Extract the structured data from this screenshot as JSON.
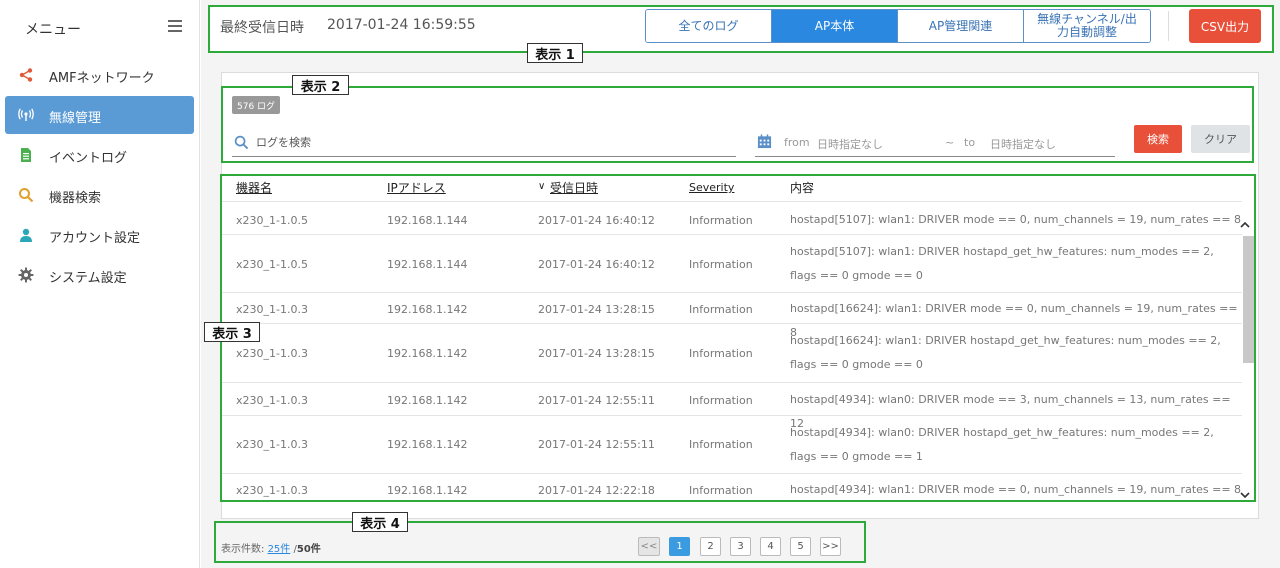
{
  "sidebar": {
    "title": "メニュー",
    "items": [
      {
        "label": "AMFネットワーク",
        "icon": "share-icon",
        "color": "#e05a3a"
      },
      {
        "label": "無線管理",
        "icon": "wireless-icon",
        "color": "#ffffff",
        "active": true
      },
      {
        "label": "イベントログ",
        "icon": "document-icon",
        "color": "#4caf50"
      },
      {
        "label": "機器検索",
        "icon": "search-icon",
        "color": "#e0a030"
      },
      {
        "label": "アカウント設定",
        "icon": "user-icon",
        "color": "#2aa8b8"
      },
      {
        "label": "システム設定",
        "icon": "gear-icon",
        "color": "#666666"
      }
    ]
  },
  "header": {
    "last_received_label": "最終受信日時",
    "last_received_time": "2017-01-24 16:59:55",
    "tabs": [
      {
        "label": "全てのログ",
        "active": false
      },
      {
        "label": "AP本体",
        "active": true
      },
      {
        "label": "AP管理関連",
        "active": false
      },
      {
        "label": "無線チャンネル/出力自動調整",
        "active": false
      }
    ],
    "csv_button": "CSV出力"
  },
  "annotations": {
    "box1": "表示 1",
    "box2": "表示 2",
    "box3": "表示 3",
    "box4": "表示 4"
  },
  "search": {
    "log_count": "576 ログ",
    "placeholder": "ログを検索",
    "from_label": "from",
    "from_value": "日時指定なし",
    "tilde": "~",
    "to_label": "to",
    "to_value": "日時指定なし",
    "search_button": "検索",
    "clear_button": "クリア"
  },
  "table": {
    "columns": [
      "機器名",
      "IPアドレス",
      "受信日時",
      "Severity",
      "内容"
    ],
    "sort_indicator": "∨",
    "rows": [
      {
        "device": "x230_1-1.0.5",
        "ip": "192.168.1.144",
        "time": "2017-01-24 16:40:12",
        "severity": "Information",
        "message": "hostapd[5107]: wlan1: DRIVER mode == 0, num_channels = 19, num_rates == 8"
      },
      {
        "device": "x230_1-1.0.5",
        "ip": "192.168.1.144",
        "time": "2017-01-24 16:40:12",
        "severity": "Information",
        "message": "hostapd[5107]: wlan1: DRIVER hostapd_get_hw_features: num_modes == 2, flags == 0 gmode == 0"
      },
      {
        "device": "x230_1-1.0.3",
        "ip": "192.168.1.142",
        "time": "2017-01-24 13:28:15",
        "severity": "Information",
        "message": "hostapd[16624]: wlan1: DRIVER mode == 0, num_channels = 19, num_rates == 8"
      },
      {
        "device": "x230_1-1.0.3",
        "ip": "192.168.1.142",
        "time": "2017-01-24 13:28:15",
        "severity": "Information",
        "message": "hostapd[16624]: wlan1: DRIVER hostapd_get_hw_features: num_modes == 2, flags == 0 gmode == 0"
      },
      {
        "device": "x230_1-1.0.3",
        "ip": "192.168.1.142",
        "time": "2017-01-24 12:55:11",
        "severity": "Information",
        "message": "hostapd[4934]: wlan0: DRIVER mode == 3, num_channels = 13, num_rates == 12"
      },
      {
        "device": "x230_1-1.0.3",
        "ip": "192.168.1.142",
        "time": "2017-01-24 12:55:11",
        "severity": "Information",
        "message": "hostapd[4934]: wlan0: DRIVER hostapd_get_hw_features: num_modes == 2, flags == 0 gmode == 1"
      },
      {
        "device": "x230_1-1.0.3",
        "ip": "192.168.1.142",
        "time": "2017-01-24 12:22:18",
        "severity": "Information",
        "message": "hostapd[4934]: wlan1: DRIVER mode == 0, num_channels = 19, num_rates == 8"
      }
    ]
  },
  "pager": {
    "display_label": "表示件数:",
    "per_page": "25件",
    "separator": "/",
    "total": "50件",
    "first": "<<",
    "pages": [
      "1",
      "2",
      "3",
      "4",
      "5"
    ],
    "current": "1",
    "last": ">>"
  }
}
